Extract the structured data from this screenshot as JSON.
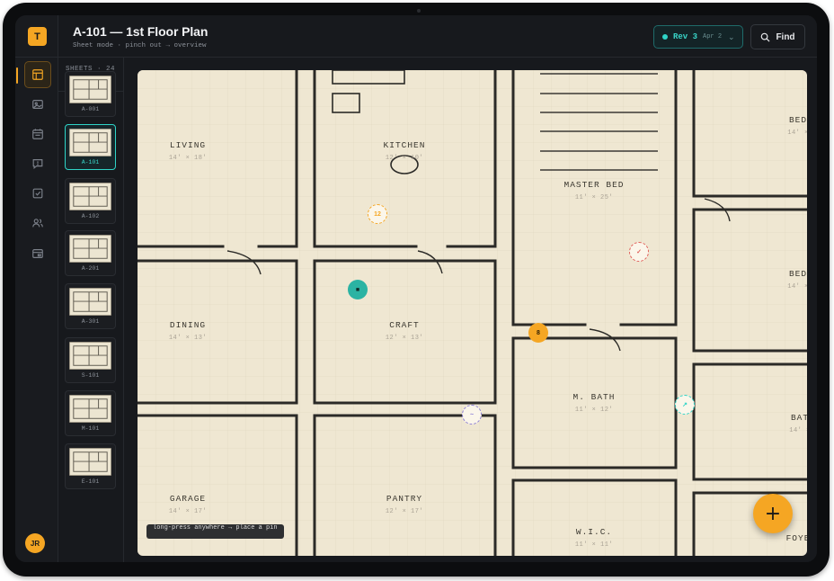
{
  "app": {
    "logo_letter": "T",
    "user_initials": "JR",
    "accent_color": "#f5a623",
    "teal_color": "#2fd4c7"
  },
  "rail": {
    "items": [
      {
        "name": "sheets",
        "icon": "layout-icon",
        "active": true
      },
      {
        "name": "photos",
        "icon": "image-icon",
        "active": false
      },
      {
        "name": "schedule",
        "icon": "calendar-icon",
        "active": false
      },
      {
        "name": "comments",
        "icon": "message-icon",
        "active": false
      },
      {
        "name": "tasks",
        "icon": "checkbox-icon",
        "active": false
      },
      {
        "name": "team",
        "icon": "users-icon",
        "active": false
      },
      {
        "name": "billing",
        "icon": "card-icon",
        "active": false
      }
    ]
  },
  "header": {
    "title": "A-101 — 1st Floor Plan",
    "subtitle": "Sheet mode · pinch out → overview",
    "revision": {
      "label": "Rev 3",
      "date": "Apr 2"
    },
    "find_label": "Find"
  },
  "sheets": {
    "heading": "SHEETS · 24",
    "items": [
      {
        "code": "A-001",
        "active": false
      },
      {
        "code": "A-101",
        "active": true
      },
      {
        "code": "A-102",
        "active": false
      },
      {
        "code": "A-201",
        "active": false
      },
      {
        "code": "A-301",
        "active": false
      },
      {
        "code": "S-101",
        "active": false
      },
      {
        "code": "M-101",
        "active": false
      },
      {
        "code": "E-101",
        "active": false
      }
    ]
  },
  "plan": {
    "rooms": [
      {
        "name": "LIVING",
        "dims": "14' × 18'"
      },
      {
        "name": "KITCHEN",
        "dims": "12' × 10'"
      },
      {
        "name": "MASTER BED",
        "dims": "11' × 25'"
      },
      {
        "name": "BED",
        "dims": "14' ×"
      },
      {
        "name": "BED",
        "dims": "14' ×"
      },
      {
        "name": "DINING",
        "dims": "14' × 13'"
      },
      {
        "name": "CRAFT",
        "dims": "12' × 13'"
      },
      {
        "name": "M. BATH",
        "dims": "11' × 12'"
      },
      {
        "name": "BAT",
        "dims": "14' ×"
      },
      {
        "name": "GARAGE",
        "dims": "14' × 17'"
      },
      {
        "name": "PANTRY",
        "dims": "12' × 17'"
      },
      {
        "name": "W.I.C.",
        "dims": "11' × 11'"
      },
      {
        "name": "FOYE",
        "dims": ""
      }
    ],
    "pins": [
      {
        "label": "12",
        "style": "dashed",
        "color": "#f5a623"
      },
      {
        "label": "■",
        "style": "solid",
        "color": "#2bb3a3"
      },
      {
        "label": "✓",
        "style": "dashed",
        "color": "#e0605a"
      },
      {
        "label": "8",
        "style": "solid",
        "color": "#f5a623"
      },
      {
        "label": "↗",
        "style": "dashed",
        "color": "#2fd4c7"
      },
      {
        "label": "~",
        "style": "dashed",
        "color": "#8d7fd6"
      }
    ],
    "hint": "long-press anywhere → place a pin",
    "fab_label": "+"
  }
}
